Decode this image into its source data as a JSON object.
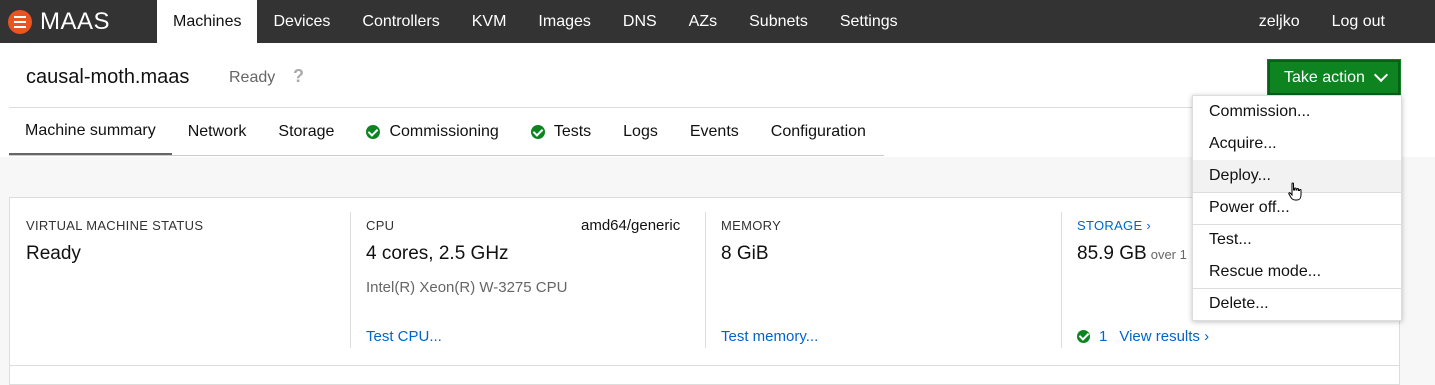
{
  "app": {
    "logo_text": "MAAS",
    "brand_color": "#e95420",
    "action_color": "#0e8420",
    "link_color": "#0066cc"
  },
  "topnav": {
    "items": [
      "Machines",
      "Devices",
      "Controllers",
      "KVM",
      "Images",
      "DNS",
      "AZs",
      "Subnets",
      "Settings"
    ],
    "active": "Machines",
    "user": "zeljko",
    "logout": "Log out"
  },
  "header": {
    "hostname": "causal-moth.maas",
    "status": "Ready",
    "help": "?",
    "take_action": "Take action"
  },
  "tabs": [
    {
      "label": "Machine summary",
      "active": true,
      "check": false
    },
    {
      "label": "Network",
      "check": false
    },
    {
      "label": "Storage",
      "check": false
    },
    {
      "label": "Commissioning",
      "check": true
    },
    {
      "label": "Tests",
      "check": true
    },
    {
      "label": "Logs",
      "check": false
    },
    {
      "label": "Events",
      "check": false
    },
    {
      "label": "Configuration",
      "check": false
    }
  ],
  "summary": {
    "vm_status": {
      "title": "VIRTUAL MACHINE STATUS",
      "value": "Ready"
    },
    "cpu": {
      "title": "CPU",
      "arch": "amd64/generic",
      "value": "4 cores, 2.5 GHz",
      "model": "Intel(R) Xeon(R) W-3275 CPU",
      "link": "Test CPU..."
    },
    "memory": {
      "title": "MEMORY",
      "value": "8 GiB",
      "link": "Test memory..."
    },
    "storage": {
      "title": "STORAGE ›",
      "value": "85.9 GB",
      "over": "over 1",
      "passed_count": "1",
      "link": "View results ›"
    }
  },
  "dropdown": {
    "items": [
      "Commission...",
      "Acquire...",
      "Deploy...",
      "Power off...",
      "Test...",
      "Rescue mode...",
      "Delete..."
    ],
    "hovered": "Deploy..."
  }
}
